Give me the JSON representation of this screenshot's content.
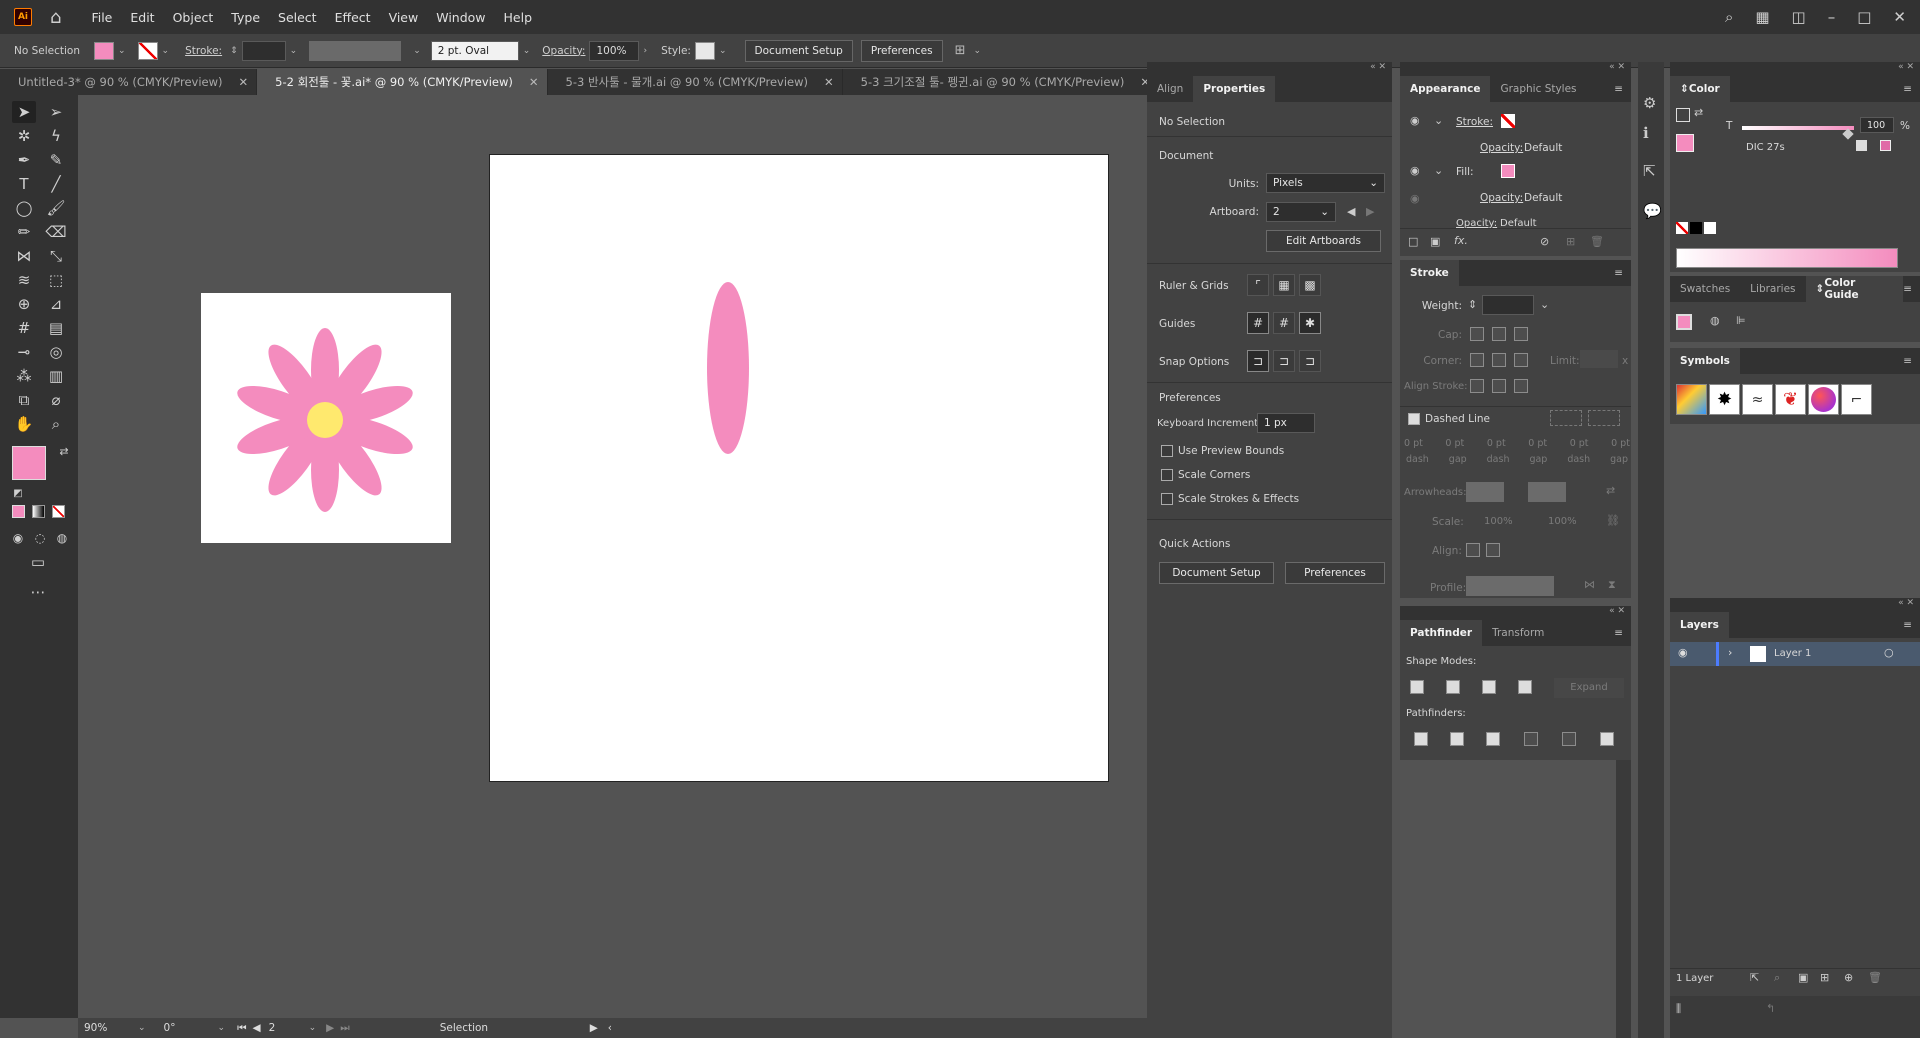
{
  "app": {
    "logo": "Ai"
  },
  "menu": [
    "File",
    "Edit",
    "Object",
    "Type",
    "Select",
    "Effect",
    "View",
    "Window",
    "Help"
  ],
  "control": {
    "selection": "No Selection",
    "stroke_label": "Stroke:",
    "brush": "2 pt. Oval",
    "opacity_label": "Opacity:",
    "opacity": "100%",
    "style_label": "Style:",
    "doc_setup": "Document Setup",
    "preferences": "Preferences"
  },
  "tabs": [
    {
      "label": "Untitled-3* @ 90 % (CMYK/Preview)",
      "active": false
    },
    {
      "label": "5-2 회전툴 - 꽃.ai* @ 90 % (CMYK/Preview)",
      "active": true
    },
    {
      "label": "5-3 반사툴 - 물개.ai @ 90 % (CMYK/Preview)",
      "active": false
    },
    {
      "label": "5-3 크기조절 툴- 펭귄.ai @ 90 % (CMYK/Preview)",
      "active": false
    }
  ],
  "status": {
    "zoom": "90%",
    "rotate": "0°",
    "artboard": "2",
    "tool": "Selection"
  },
  "properties": {
    "tabs": [
      "Align",
      "Properties"
    ],
    "no_selection": "No Selection",
    "document": "Document",
    "units_label": "Units:",
    "units": "Pixels",
    "artboard_label": "Artboard:",
    "artboard": "2",
    "edit_artboards": "Edit Artboards",
    "ruler_grids": "Ruler & Grids",
    "guides": "Guides",
    "snap_options": "Snap Options",
    "preferences": "Preferences",
    "keyboard_increment_label": "Keyboard Increment:",
    "keyboard_increment": "1 px",
    "use_preview_bounds": "Use Preview Bounds",
    "scale_corners": "Scale Corners",
    "scale_strokes": "Scale Strokes & Effects",
    "quick_actions": "Quick Actions",
    "doc_setup": "Document Setup",
    "preferences_btn": "Preferences"
  },
  "appearance": {
    "tabs": [
      "Appearance",
      "Graphic Styles"
    ],
    "stroke": "Stroke:",
    "opacity1": "Opacity:",
    "opacity1_val": "Default",
    "fill": "Fill:",
    "opacity2": "Opacity:",
    "opacity2_val": "Default",
    "opacity3": "Opacity:",
    "opacity3_val": "Default"
  },
  "stroke_panel": {
    "title": "Stroke",
    "weight": "Weight:",
    "cap": "Cap:",
    "corner": "Corner:",
    "limit": "Limit:",
    "limit_x": "x",
    "align_stroke": "Align Stroke:",
    "dashed_line": "Dashed Line",
    "dash_vals": [
      "0 pt",
      "0 pt",
      "0 pt",
      "0 pt",
      "0 pt",
      "0 pt"
    ],
    "dash_lbls": [
      "dash",
      "gap",
      "dash",
      "gap",
      "dash",
      "gap"
    ],
    "arrowheads": "Arrowheads:",
    "scale": "Scale:",
    "scale1": "100%",
    "scale2": "100%",
    "align": "Align:",
    "profile": "Profile:"
  },
  "pathfinder": {
    "tabs": [
      "Pathfinder",
      "Transform"
    ],
    "shape_modes": "Shape Modes:",
    "expand": "Expand",
    "pathfinders": "Pathfinders:"
  },
  "color": {
    "title": "Color",
    "t_label": "T",
    "value": "100",
    "pct": "%",
    "swatch_name": "DIC 27s",
    "fill_color": "#f48cbe"
  },
  "swatches": {
    "tabs": [
      "Swatches",
      "Libraries",
      "Color Guide"
    ]
  },
  "symbols": {
    "title": "Symbols"
  },
  "layers": {
    "title": "Layers",
    "layer": "Layer 1",
    "count": "1 Layer"
  }
}
